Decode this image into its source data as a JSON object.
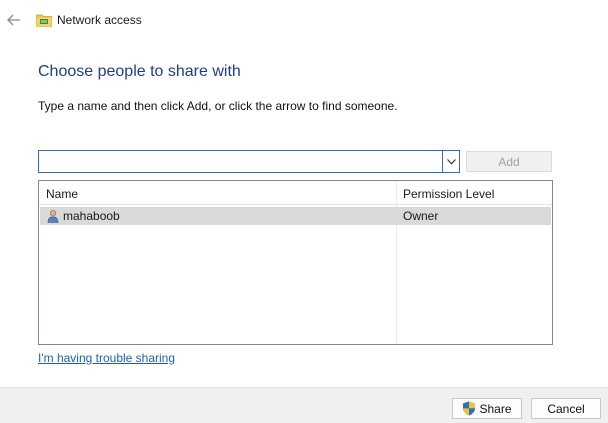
{
  "window": {
    "title": "Network access"
  },
  "header": {
    "heading": "Choose people to share with",
    "instruction": "Type a name and then click Add, or click the arrow to find someone."
  },
  "picker": {
    "input_value": "",
    "add_label": "Add"
  },
  "list": {
    "columns": [
      "Name",
      "Permission Level"
    ],
    "rows": [
      {
        "name": "mahaboob",
        "permission": "Owner",
        "selected": true
      }
    ]
  },
  "links": {
    "trouble": "I'm having trouble sharing"
  },
  "footer": {
    "share_label": "Share",
    "cancel_label": "Cancel"
  },
  "icons": {
    "back": "back-arrow-icon",
    "title": "network-folder-icon",
    "user": "user-icon",
    "dropdown": "chevron-down-icon",
    "share": "uac-shield-icon"
  },
  "colors": {
    "heading": "#1e3d8f",
    "link": "#1f5fb5",
    "selected_row": "#d9d9d9",
    "footer_bg": "#f0f0f0",
    "combo_border": "#2f6fb8"
  }
}
